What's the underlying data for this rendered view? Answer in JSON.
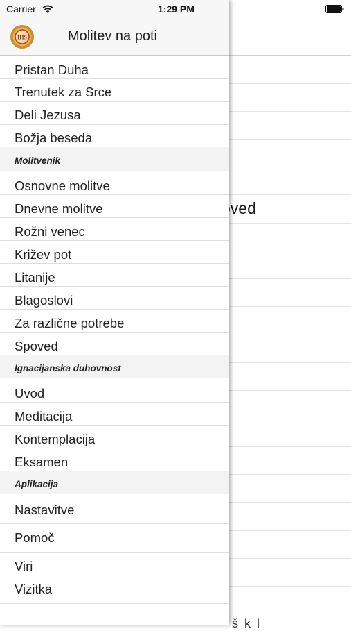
{
  "status_bar": {
    "carrier": "Carrier",
    "time": "1:29 PM"
  },
  "drawer": {
    "title": "Molitev na poti",
    "items_top": [
      "Pristan Duha",
      "Trenutek za Srce",
      "Deli Jezusa",
      "Božja beseda"
    ],
    "sections": [
      {
        "title": "Molitvenik",
        "items": [
          "Osnovne molitve",
          "Dnevne molitve",
          "Rožni venec",
          "Križev pot",
          "Litanije",
          "Blagoslovi",
          "Za različne potrebe",
          "Spoved"
        ]
      },
      {
        "title": "Ignacijanska duhovnost",
        "items": [
          "Uvod",
          "Meditacija",
          "Kontemplacija",
          "Eksamen"
        ]
      },
      {
        "title": "Aplikacija",
        "items": [
          "Nastavitve",
          "Pomoč",
          "Viri",
          "Vizitka"
        ]
      }
    ]
  },
  "background": {
    "partial_text": "oved",
    "partial_bottom": "š k l"
  },
  "colors": {
    "logo_gold": "#c9902a",
    "logo_red": "#c0392b",
    "section_bg": "#f3f3f3"
  }
}
